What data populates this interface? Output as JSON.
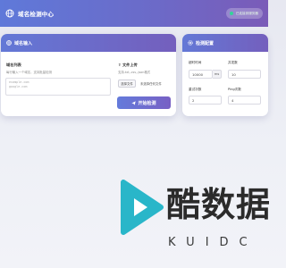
{
  "app": {
    "title": "域名检测中心",
    "status": "已连接到服务器"
  },
  "domain_card": {
    "header": "域名输入",
    "list_title": "域名列表",
    "list_hint": "每行输入一个域名，支持批量检测",
    "textarea_placeholder": "example.com\ngoogle.com",
    "upload_title": "文件上传",
    "upload_hint": "支持.txt,.csv,.json格式",
    "choose_file_label": "选择文件",
    "file_status": "未选择任何文件",
    "start_button": "开始检测"
  },
  "settings_card": {
    "header": "检测配置",
    "timeout_label": "超时时间",
    "timeout_value": "10000",
    "timeout_unit": "ms",
    "concurrency_label": "并发数",
    "concurrency_value": "10",
    "retry_label": "重试次数",
    "retry_value": "2",
    "ping_label": "Ping次数",
    "ping_value": "4"
  },
  "watermark": {
    "text": "酷数据",
    "sub": "KUIDC"
  },
  "colors": {
    "header_gradient_start": "#5f79d9",
    "header_gradient_end": "#7a5bb8",
    "status_dot": "#34d399",
    "watermark_teal": "#29b6c9"
  }
}
